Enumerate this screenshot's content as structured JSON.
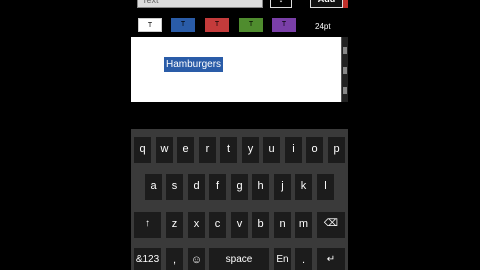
{
  "toolbar": {
    "text_value": "Text",
    "mic_glyph": "↓",
    "add_label": "Add"
  },
  "colors": {
    "chips": [
      {
        "glyph": "T",
        "bg": "#ffffff",
        "fg": "#000000",
        "name": "white"
      },
      {
        "glyph": "T",
        "bg": "#2a5ca8",
        "fg": "#000000",
        "name": "blue"
      },
      {
        "glyph": "T",
        "bg": "#c43b3b",
        "fg": "#000000",
        "name": "red"
      },
      {
        "glyph": "T",
        "bg": "#4f8c2e",
        "fg": "#000000",
        "name": "green"
      },
      {
        "glyph": "T",
        "bg": "#7a3fa8",
        "fg": "#000000",
        "name": "purple"
      }
    ],
    "accent": "#c0302a"
  },
  "size": {
    "label": "24pt"
  },
  "canvas": {
    "selected_text": "Hamburgers"
  },
  "keyboard": {
    "row1": [
      "q",
      "w",
      "e",
      "r",
      "t",
      "y",
      "u",
      "i",
      "o",
      "p"
    ],
    "row2": [
      "a",
      "s",
      "d",
      "f",
      "g",
      "h",
      "j",
      "k",
      "l"
    ],
    "row3": [
      "↑",
      "z",
      "x",
      "c",
      "v",
      "b",
      "n",
      "m",
      "⌫"
    ],
    "row4": {
      "symbols": "&123",
      "comma": ",",
      "emoji": "☺",
      "space": "space",
      "lang": "En",
      "period": ".",
      "enter": "↵"
    }
  }
}
